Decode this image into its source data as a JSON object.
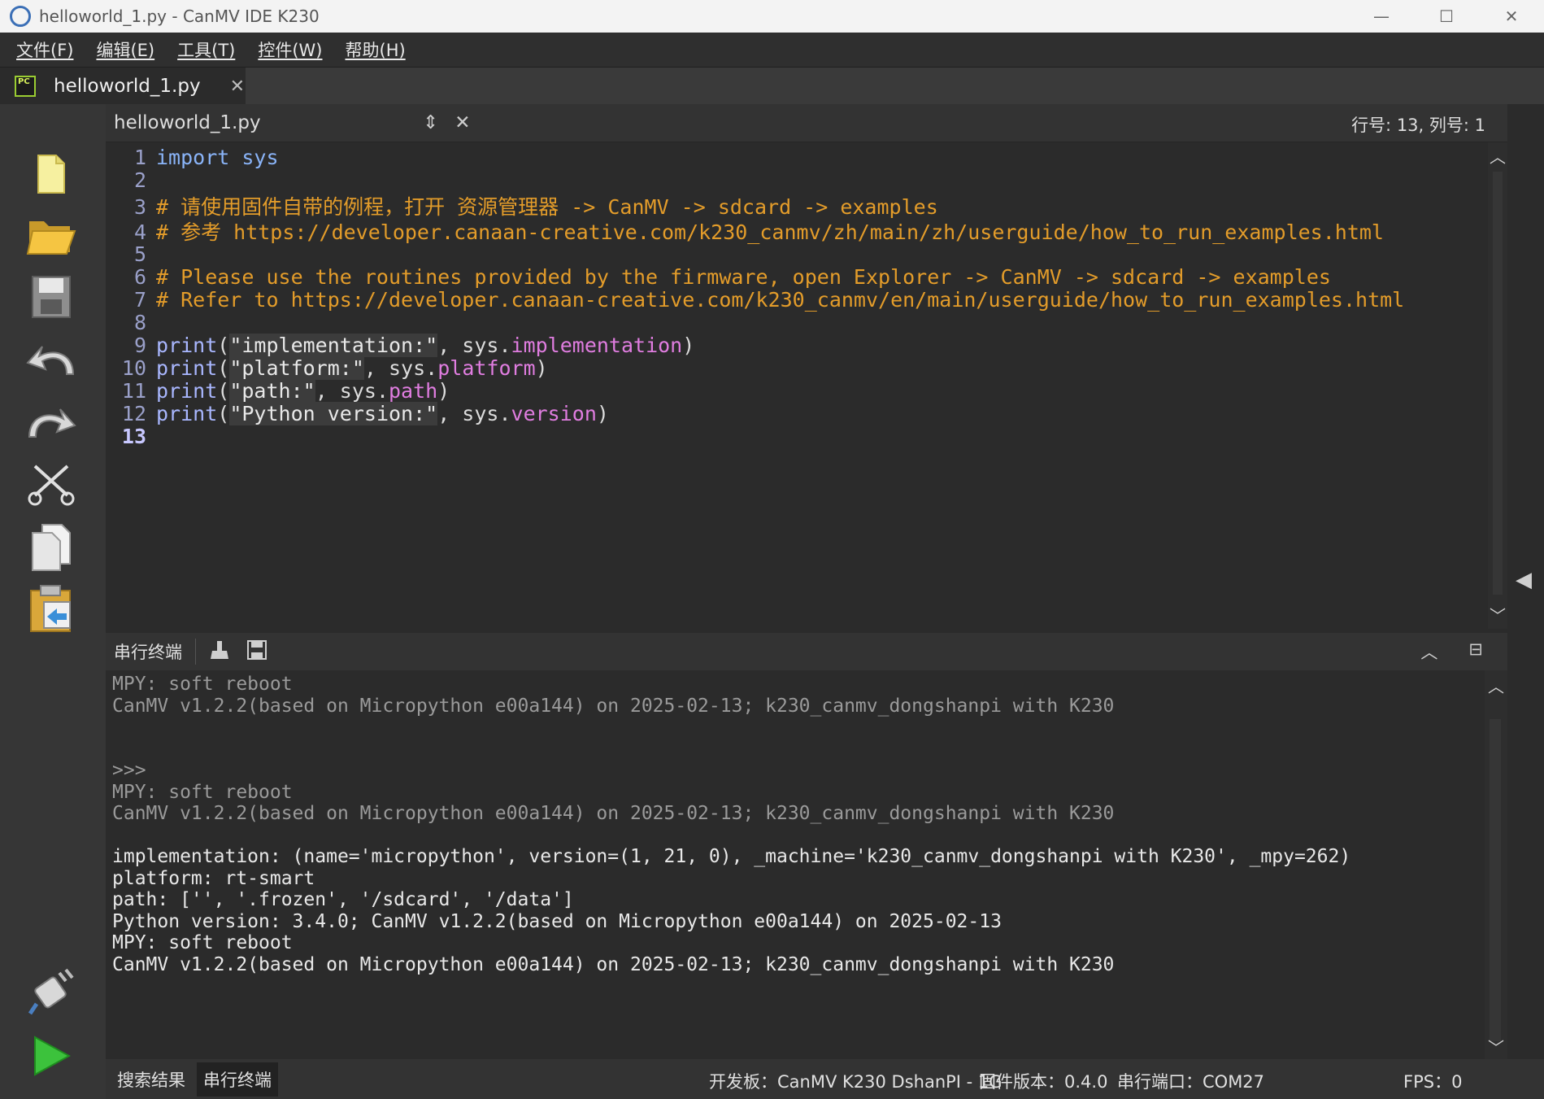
{
  "window": {
    "title": "helloworld_1.py - CanMV IDE K230",
    "minimize": "—",
    "maximize": "☐",
    "close": "✕"
  },
  "menu": [
    "文件(F)",
    "编辑(E)",
    "工具(T)",
    "控件(W)",
    "帮助(H)"
  ],
  "tab": {
    "icon_text": "PC",
    "label": "helloworld_1.py",
    "close": "✕"
  },
  "editor_header": {
    "doc_name": "helloworld_1.py",
    "cursor_position": "行号: 13, 列号: 1"
  },
  "toolbar_icons": [
    "new-file-icon",
    "open-folder-icon",
    "save-icon",
    "undo-icon",
    "redo-icon",
    "cut-icon",
    "copy-icon",
    "paste-icon",
    "connect-icon",
    "run-icon"
  ],
  "code": [
    {
      "n": "1",
      "parts": [
        {
          "t": "import",
          "c": "kw-import"
        },
        {
          "t": " ",
          "c": "plain"
        },
        {
          "t": "sys",
          "c": "kw-import"
        }
      ]
    },
    {
      "n": "2",
      "parts": []
    },
    {
      "n": "3",
      "parts": [
        {
          "t": "# 请使用固件自带的例程，打开 资源管理器 -> CanMV -> sdcard -> examples",
          "c": "comment"
        }
      ]
    },
    {
      "n": "4",
      "parts": [
        {
          "t": "# 参考 https://developer.canaan-creative.com/k230_canmv/zh/main/zh/userguide/how_to_run_examples.html",
          "c": "comment"
        }
      ]
    },
    {
      "n": "5",
      "parts": []
    },
    {
      "n": "6",
      "parts": [
        {
          "t": "# Please use the routines provided by the firmware, open Explorer -> CanMV -> sdcard -> examples",
          "c": "comment"
        }
      ]
    },
    {
      "n": "7",
      "parts": [
        {
          "t": "# Refer to https://developer.canaan-creative.com/k230_canmv/en/main/userguide/how_to_run_examples.html",
          "c": "comment"
        }
      ]
    },
    {
      "n": "8",
      "parts": []
    },
    {
      "n": "9",
      "parts": [
        {
          "t": "print",
          "c": "kw-fn"
        },
        {
          "t": "(",
          "c": "plain"
        },
        {
          "t": "\"implementation:\"",
          "c": "str"
        },
        {
          "t": ", sys.",
          "c": "plain"
        },
        {
          "t": "implementation",
          "c": "attr"
        },
        {
          "t": ")",
          "c": "plain"
        }
      ]
    },
    {
      "n": "10",
      "parts": [
        {
          "t": "print",
          "c": "kw-fn"
        },
        {
          "t": "(",
          "c": "plain"
        },
        {
          "t": "\"platform:\"",
          "c": "str"
        },
        {
          "t": ", sys.",
          "c": "plain"
        },
        {
          "t": "platform",
          "c": "attr"
        },
        {
          "t": ")",
          "c": "plain"
        }
      ]
    },
    {
      "n": "11",
      "parts": [
        {
          "t": "print",
          "c": "kw-fn"
        },
        {
          "t": "(",
          "c": "plain"
        },
        {
          "t": "\"path:\"",
          "c": "str"
        },
        {
          "t": ", sys.",
          "c": "plain"
        },
        {
          "t": "path",
          "c": "attr"
        },
        {
          "t": ")",
          "c": "plain"
        }
      ]
    },
    {
      "n": "12",
      "parts": [
        {
          "t": "print",
          "c": "kw-fn"
        },
        {
          "t": "(",
          "c": "plain"
        },
        {
          "t": "\"Python version:\"",
          "c": "str"
        },
        {
          "t": ", sys.",
          "c": "plain"
        },
        {
          "t": "version",
          "c": "attr"
        },
        {
          "t": ")",
          "c": "plain"
        }
      ]
    },
    {
      "n": "13",
      "parts": []
    }
  ],
  "current_line": "13",
  "terminal": {
    "title": "串行终端",
    "lines": [
      {
        "t": "MPY: soft reboot",
        "c": "old"
      },
      {
        "t": "CanMV v1.2.2(based on Micropython e00a144) on 2025-02-13; k230_canmv_dongshanpi with K230",
        "c": "old"
      },
      {
        "t": "",
        "c": "old"
      },
      {
        "t": "",
        "c": "old"
      },
      {
        "t": ">>>",
        "c": "old"
      },
      {
        "t": "MPY: soft reboot",
        "c": "old"
      },
      {
        "t": "CanMV v1.2.2(based on Micropython e00a144) on 2025-02-13; k230_canmv_dongshanpi with K230",
        "c": "old"
      },
      {
        "t": "",
        "c": "old"
      },
      {
        "t": "implementation: (name='micropython', version=(1, 21, 0), _machine='k230_canmv_dongshanpi with K230', _mpy=262)",
        "c": "new"
      },
      {
        "t": "platform: rt-smart",
        "c": "new"
      },
      {
        "t": "path: ['', '.frozen', '/sdcard', '/data']",
        "c": "new"
      },
      {
        "t": "Python version: 3.4.0; CanMV v1.2.2(based on Micropython e00a144) on 2025-02-13",
        "c": "new"
      },
      {
        "t": "MPY: soft reboot",
        "c": "new"
      },
      {
        "t": "CanMV v1.2.2(based on Micropython e00a144) on 2025-02-13; k230_canmv_dongshanpi with K230",
        "c": "new"
      }
    ]
  },
  "status": {
    "tab_search": "搜索结果",
    "tab_terminal": "串行终端",
    "board": "开发板：CanMV K230 DshanPI - 1G",
    "firmware": "固件版本：0.4.0",
    "port": "串行端口：COM27",
    "fps": "FPS：0"
  }
}
